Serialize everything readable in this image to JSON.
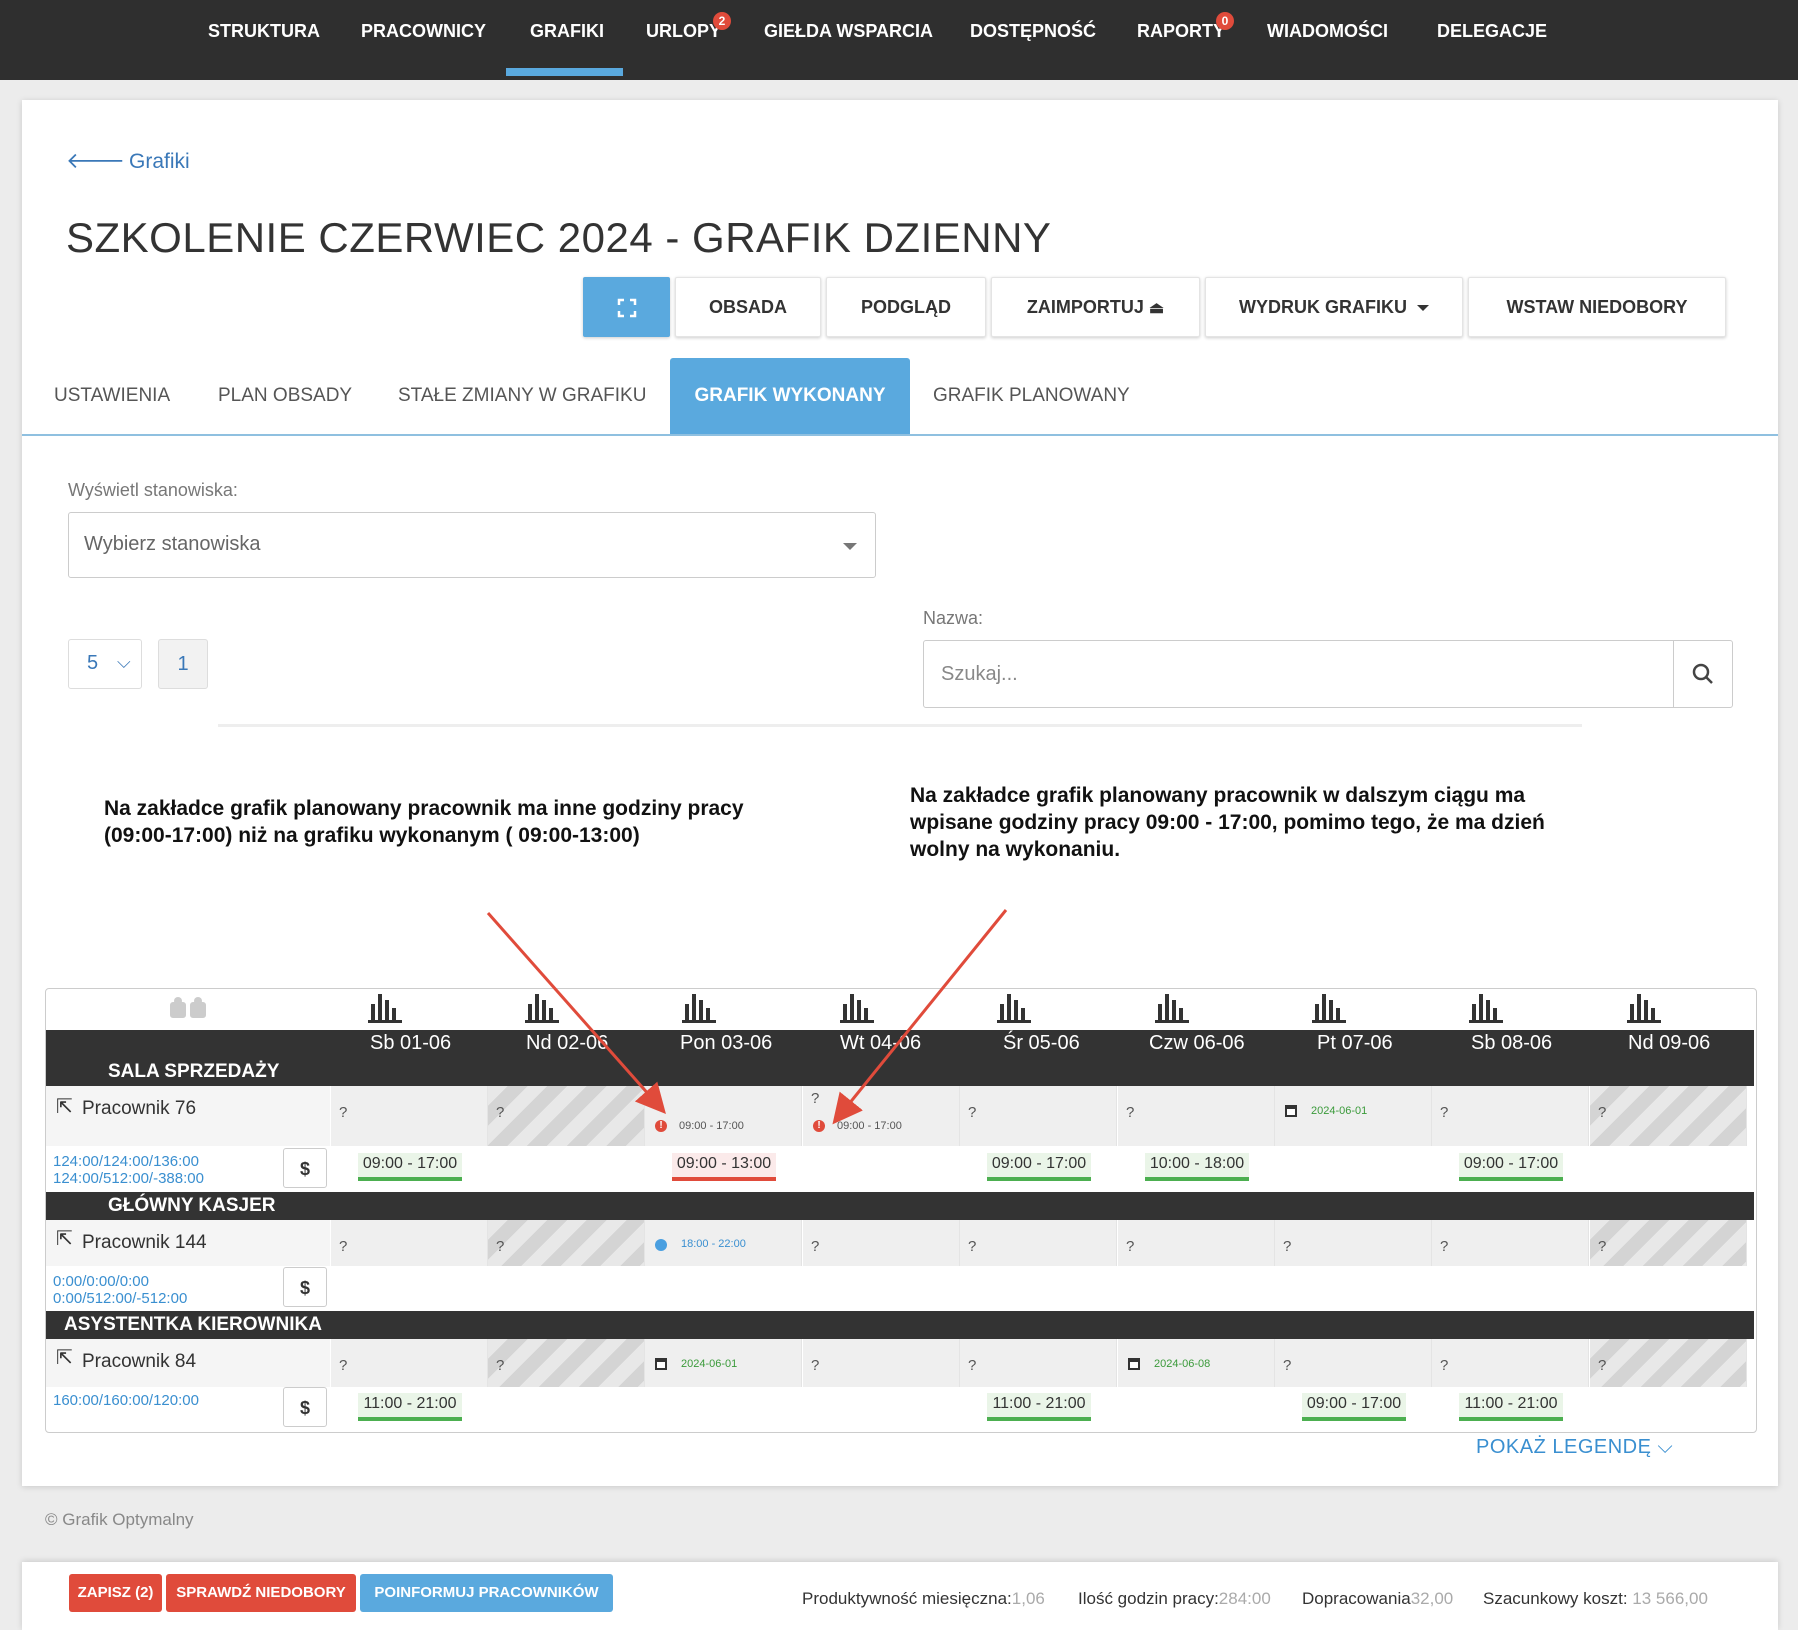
{
  "nav": {
    "items": [
      "STRUKTURA",
      "PRACOWNICY",
      "GRAFIKI",
      "URLOPY",
      "GIEŁDA WSPARCIA",
      "DOSTĘPNOŚĆ",
      "RAPORTY",
      "WIADOMOŚCI",
      "DELEGACJE"
    ],
    "badges": {
      "urlopy": "2",
      "raporty": "0"
    },
    "active": "GRAFIKI"
  },
  "back_label": "Grafiki",
  "page_title": "SZKOLENIE CZERWIEC 2024 - GRAFIK DZIENNY",
  "toolbar": {
    "obsada": "OBSADA",
    "podglad": "PODGLĄD",
    "zaimportuj": "ZAIMPORTUJ",
    "wydruk": "WYDRUK GRAFIKU",
    "wstaw": "WSTAW NIEDOBORY"
  },
  "tabs": [
    "USTAWIENIA",
    "PLAN OBSADY",
    "STAŁE ZMIANY W GRAFIKU",
    "GRAFIK WYKONANY",
    "GRAFIK PLANOWANY"
  ],
  "filter": {
    "label": "Wyświetl stanowiska:",
    "placeholder": "Wybierz stanowiska"
  },
  "pagination": {
    "page_size": "5",
    "page": "1"
  },
  "search": {
    "label": "Nazwa:",
    "placeholder": "Szukaj..."
  },
  "notes": {
    "left": "Na zakładce grafik planowany pracownik ma inne godziny pracy (09:00-17:00) niż na grafiku wykonanym ( 09:00-13:00)",
    "right": "Na zakładce grafik planowany pracownik w dalszym ciągu ma wpisane godziny pracy 09:00 - 17:00, pomimo tego, że ma dzień wolny na wykonaniu."
  },
  "days": [
    "Sb 01-06",
    "Nd 02-06",
    "Pon 03-06",
    "Wt 04-06",
    "Śr 05-06",
    "Czw 06-06",
    "Pt 07-06",
    "Sb 08-06",
    "Nd 09-06"
  ],
  "sections": [
    {
      "name": "SALA SPRZEDAŻY",
      "employee": "Pracownik 76",
      "stats": [
        "124:00/124:00/136:00",
        "124:00/512:00/-388:00"
      ],
      "plan_cells": [
        "?",
        "?",
        "09:00 - 17:00",
        "09:00 - 17:00",
        "?",
        "?",
        "2024-06-01",
        "?",
        "?"
      ],
      "shifts": [
        "09:00 - 17:00",
        "",
        "09:00 - 13:00",
        "",
        "09:00 - 17:00",
        "10:00 - 18:00",
        "",
        "09:00 - 17:00",
        ""
      ]
    },
    {
      "name": "GŁÓWNY KASJER",
      "employee": "Pracownik 144",
      "stats": [
        "0:00/0:00/0:00",
        "0:00/512:00/-512:00"
      ],
      "plan_cells": [
        "?",
        "?",
        "18:00 - 22:00",
        "?",
        "?",
        "?",
        "?",
        "?",
        "?"
      ],
      "shifts": [
        "",
        "",
        "",
        "",
        "",
        "",
        "",
        "",
        ""
      ]
    },
    {
      "name": "ASYSTENTKA KIEROWNIKA",
      "employee": "Pracownik 84",
      "stats": [
        "160:00/160:00/120:00"
      ],
      "plan_cells": [
        "?",
        "?",
        "2024-06-01",
        "?",
        "?",
        "2024-06-08",
        "?",
        "?",
        "?"
      ],
      "shifts": [
        "11:00 - 21:00",
        "",
        "",
        "",
        "11:00 - 21:00",
        "",
        "09:00 - 17:00",
        "11:00 - 21:00",
        ""
      ]
    }
  ],
  "dollar": "$",
  "legend_label": "POKAŻ LEGENDĘ",
  "footer": "© Grafik Optymalny",
  "bottom": {
    "zapisz": "ZAPISZ (2)",
    "sprawdz": "SPRAWDŹ NIEDOBORY",
    "poinformuj": "POINFORMUJ PRACOWNIKÓW",
    "prod_label": "Produktywność miesięczna:",
    "prod_value": "1,06",
    "hours_label": "Ilość godzin pracy:",
    "hours_value": "284:00",
    "extra_label": "Dopracowania",
    "extra_value": "32,00",
    "cost_label": "Szacunkowy koszt:",
    "cost_value": "13 566,00"
  },
  "colors": {
    "accent": "#5aa9de",
    "nav_bg": "#2f2f2f",
    "danger": "#e04b3b",
    "shift_ok": "#4caf50"
  }
}
